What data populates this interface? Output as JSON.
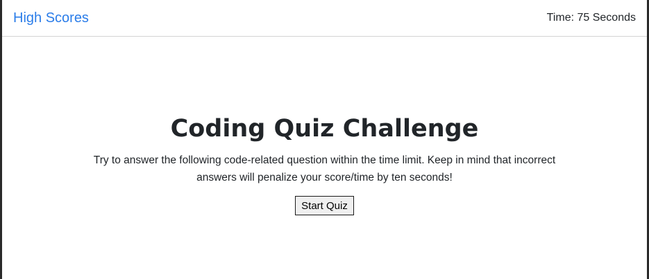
{
  "navbar": {
    "high_scores_link": "High Scores",
    "timer_text": "Time: 75 Seconds"
  },
  "main": {
    "title": "Coding Quiz Challenge",
    "description": "Try to answer the following code-related question within the time limit. Keep in mind that incorrect answers will penalize your score/time by ten seconds!",
    "start_button_label": "Start Quiz"
  },
  "colors": {
    "link": "#2b7de9",
    "text": "#212529",
    "button_bg": "#efefef",
    "frame_border": "#2a2a2a"
  }
}
